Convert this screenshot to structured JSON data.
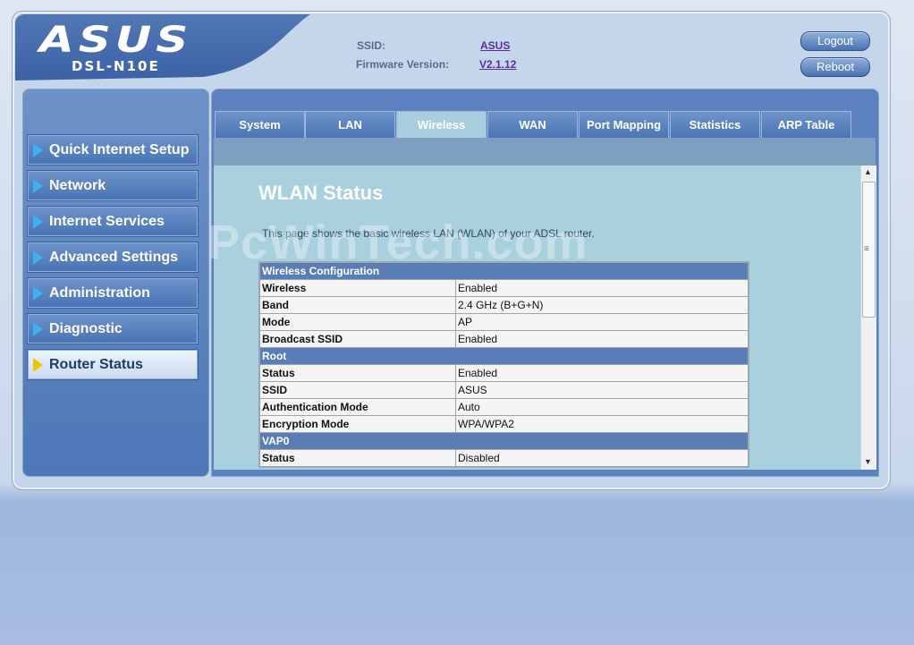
{
  "header": {
    "brand": "ASUS",
    "model": "DSL-N10E",
    "ssid_label": "SSID:",
    "ssid_value": "ASUS",
    "firmware_label": "Firmware Version:",
    "firmware_value": "V2.1.12",
    "logout_label": "Logout",
    "reboot_label": "Reboot"
  },
  "sidebar": {
    "items": [
      {
        "label": "Quick Internet Setup"
      },
      {
        "label": "Network"
      },
      {
        "label": "Internet Services"
      },
      {
        "label": "Advanced Settings"
      },
      {
        "label": "Administration"
      },
      {
        "label": "Diagnostic"
      },
      {
        "label": "Router Status",
        "active": true
      }
    ]
  },
  "tabs": [
    "System",
    "LAN",
    "Wireless",
    "WAN",
    "Port Mapping",
    "Statistics",
    "ARP Table"
  ],
  "active_tab": "Wireless",
  "main": {
    "title": "WLAN Status",
    "description": "This page shows the basic wireless LAN (WLAN) of your ADSL router.",
    "watermark": "PcWinTech.com"
  },
  "table": {
    "sections": [
      {
        "title": "Wireless Configuration",
        "rows": [
          [
            "Wireless",
            "Enabled"
          ],
          [
            "Band",
            "2.4 GHz (B+G+N)"
          ],
          [
            "Mode",
            "AP"
          ],
          [
            "Broadcast SSID",
            "Enabled"
          ]
        ]
      },
      {
        "title": "Root",
        "rows": [
          [
            "Status",
            "Enabled"
          ],
          [
            "SSID",
            "ASUS"
          ],
          [
            "Authentication Mode",
            "Auto"
          ],
          [
            "Encryption Mode",
            "WPA/WPA2"
          ]
        ]
      },
      {
        "title": "VAP0",
        "rows": [
          [
            "Status",
            "Disabled"
          ]
        ]
      }
    ]
  },
  "colors": {
    "accent": "#4b73b3",
    "active_tab": "#a8cede",
    "section_header": "#5a7db5",
    "menu_arrow": "#3fb0ee",
    "menu_arrow_active": "#f0c400"
  },
  "icons": {
    "menu_arrow": "triangle-right-icon",
    "scroll_up": "arrow-up-icon",
    "scroll_down": "arrow-down-icon"
  }
}
